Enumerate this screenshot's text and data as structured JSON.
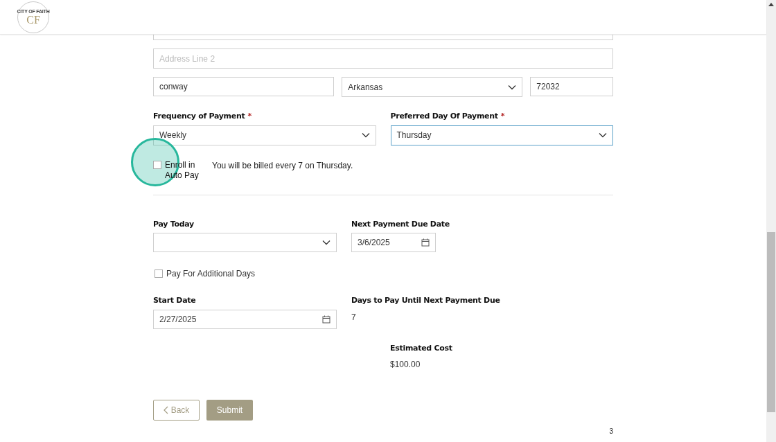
{
  "logo": {
    "title": "CITY OF FAITH",
    "mark": "CF"
  },
  "address": {
    "line2": {
      "placeholder": "Address Line 2"
    },
    "city": {
      "value": "conway"
    },
    "state": {
      "value": "Arkansas"
    },
    "zip": {
      "value": "72032"
    }
  },
  "frequency": {
    "label": "Frequency of Payment",
    "required_mark": "*",
    "value": "Weekly",
    "focused": false
  },
  "preferred_day": {
    "label": "Preferred Day Of Payment",
    "required_mark": "*",
    "value": "Thursday",
    "focused": true
  },
  "autopay": {
    "label": "Enroll in Auto Pay",
    "checked": false
  },
  "billing_note": "You will be billed every 7 on Thursday.",
  "pay_today": {
    "label": "Pay Today"
  },
  "next_due": {
    "label": "Next Payment Due Date",
    "value": "3/6/2025"
  },
  "additional_days": {
    "label": "Pay For Additional Days",
    "checked": false
  },
  "start_date": {
    "label": "Start Date",
    "value": "2/27/2025"
  },
  "days_to_pay": {
    "label": "Days to Pay Until Next Payment Due",
    "value": "7"
  },
  "estimated_cost": {
    "label": "Estimated Cost",
    "value": "$100.00"
  },
  "buttons": {
    "back": "Back",
    "submit": "Submit"
  },
  "page_number": "3"
}
